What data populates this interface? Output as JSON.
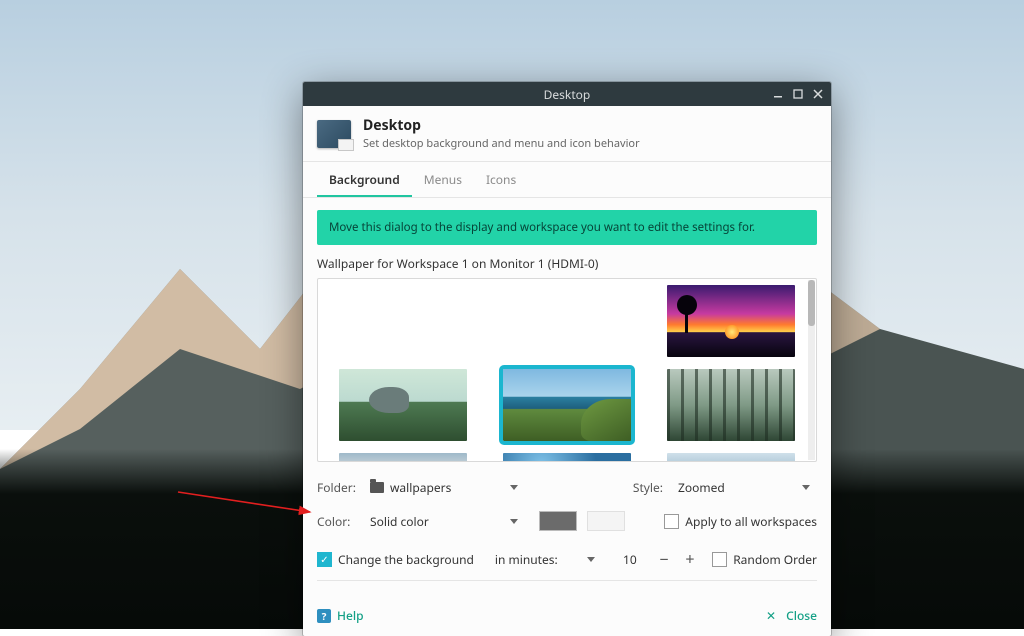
{
  "window": {
    "title": "Desktop"
  },
  "header": {
    "title": "Desktop",
    "subtitle": "Set desktop background and menu and icon behavior"
  },
  "tabs": [
    {
      "label": "Background",
      "active": true
    },
    {
      "label": "Menus",
      "active": false
    },
    {
      "label": "Icons",
      "active": false
    }
  ],
  "banner": "Move this dialog to the display and workspace you want to edit the settings for.",
  "wallpaper_section_label": "Wallpaper for Workspace 1 on Monitor 1 (HDMI-0)",
  "form": {
    "folder_label": "Folder:",
    "folder_value": "wallpapers",
    "style_label": "Style:",
    "style_value": "Zoomed",
    "color_label": "Color:",
    "color_value": "Solid color",
    "apply_all_label": "Apply to all workspaces",
    "apply_all_checked": false,
    "change_bg_label": "Change the background",
    "change_bg_checked": true,
    "interval_unit": "in minutes:",
    "interval_value": "10",
    "random_label": "Random Order",
    "random_checked": false
  },
  "footer": {
    "help_label": "Help",
    "close_label": "Close"
  }
}
